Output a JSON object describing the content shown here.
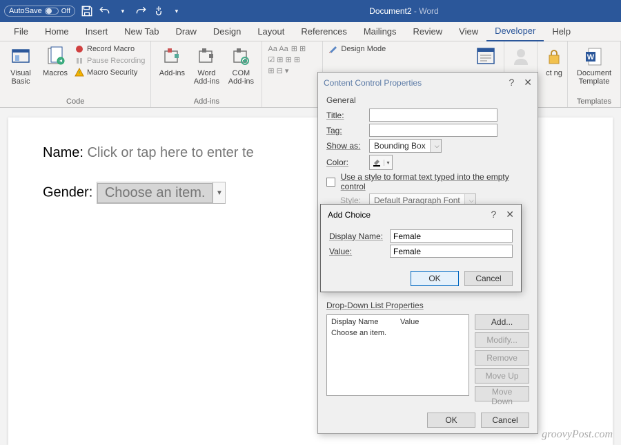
{
  "titlebar": {
    "autosave": "AutoSave",
    "autosave_state": "Off",
    "doc_name": "Document2",
    "app_suffix": " - Word"
  },
  "tabs": [
    "File",
    "Home",
    "Insert",
    "New Tab",
    "Draw",
    "Design",
    "Layout",
    "References",
    "Mailings",
    "Review",
    "View",
    "Developer",
    "Help"
  ],
  "active_tab": "Developer",
  "ribbon": {
    "code": {
      "visual_basic": "Visual Basic",
      "macros": "Macros",
      "record": "Record Macro",
      "pause": "Pause Recording",
      "security": "Macro Security",
      "label": "Code"
    },
    "addins": {
      "addins": "Add-ins",
      "word": "Word Add-ins",
      "com": "COM Add-ins",
      "label": "Add-ins"
    },
    "controls": {
      "design": "Design Mode",
      "label": ""
    },
    "protect": {
      "restrict": "ct ng"
    },
    "template": {
      "btn": "Document Template",
      "label": "Templates"
    }
  },
  "document": {
    "name_label": "Name: ",
    "name_placeholder": "Click or tap here to enter te",
    "gender_label": "Gender: ",
    "gender_placeholder": "Choose an item."
  },
  "props_dialog": {
    "title": "Content Control Properties",
    "general": "General",
    "title_label": "Title:",
    "tag_label": "Tag:",
    "show_as_label": "Show as:",
    "show_as_value": "Bounding Box",
    "color_label": "Color:",
    "use_style": "Use a style to format text typed into the empty control",
    "style_label": "Style:",
    "style_value": "Default Paragraph Font",
    "ddl_label": "Drop-Down List Properties",
    "col_display": "Display Name",
    "col_value": "Value",
    "item0": "Choose an item.",
    "add": "Add...",
    "modify": "Modify...",
    "remove": "Remove",
    "moveup": "Move Up",
    "movedown": "Move Down",
    "ok": "OK",
    "cancel": "Cancel"
  },
  "addchoice": {
    "title": "Add Choice",
    "display_name_label": "Display Name:",
    "display_name_value": "Female",
    "value_label": "Value:",
    "value_value": "Female",
    "ok": "OK",
    "cancel": "Cancel"
  },
  "watermark": "groovyPost.com"
}
